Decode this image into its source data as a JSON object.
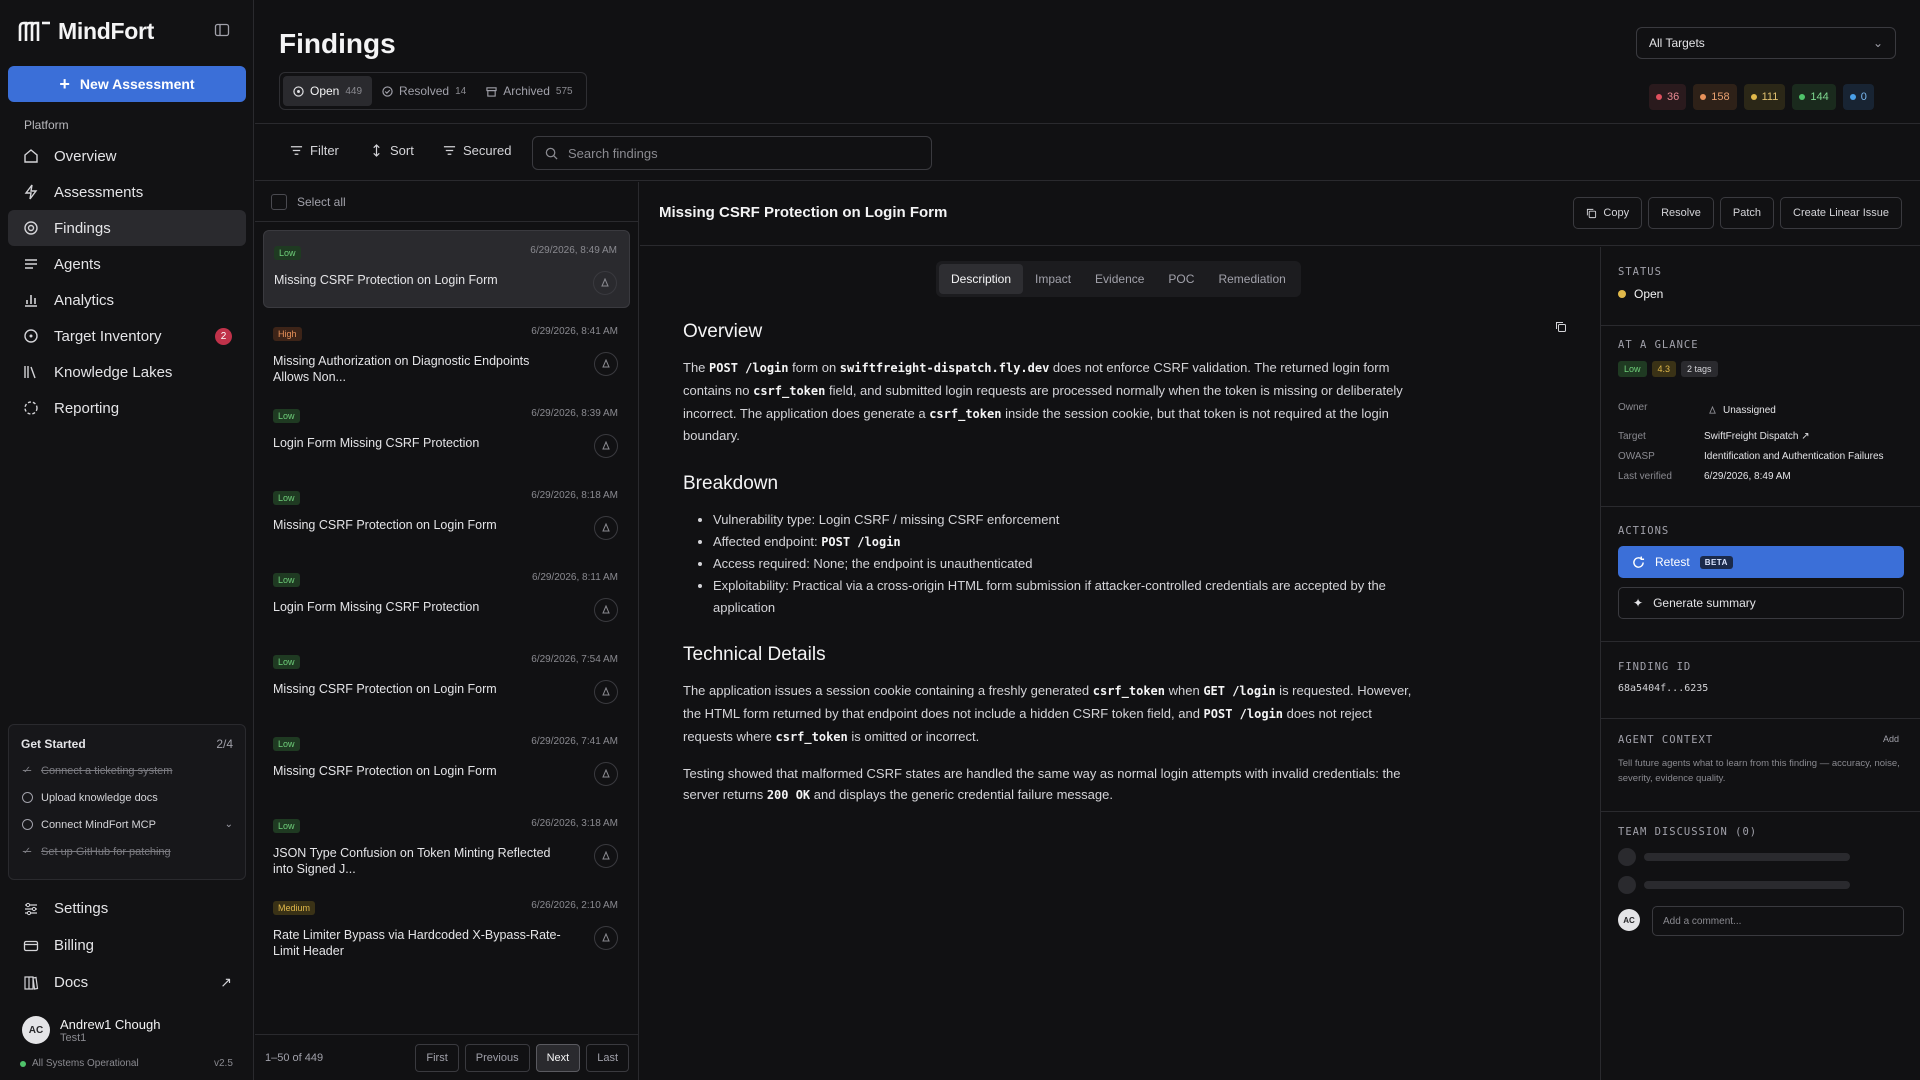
{
  "app": {
    "name": "MindFort"
  },
  "sidebar": {
    "new_assessment": "New Assessment",
    "section_label": "Platform",
    "items": [
      {
        "label": "Overview",
        "icon": "home-icon"
      },
      {
        "label": "Assessments",
        "icon": "bolt-icon"
      },
      {
        "label": "Findings",
        "icon": "target-icon",
        "active": true
      },
      {
        "label": "Agents",
        "icon": "list-icon"
      },
      {
        "label": "Analytics",
        "icon": "bar-chart-icon"
      },
      {
        "label": "Target Inventory",
        "icon": "crosshair-icon",
        "badge": "2"
      },
      {
        "label": "Knowledge Lakes",
        "icon": "library-icon"
      },
      {
        "label": "Reporting",
        "icon": "loader-icon"
      }
    ],
    "get_started": {
      "title": "Get Started",
      "progress": "2/4",
      "steps": [
        {
          "label": "Connect a ticketing system",
          "done": true
        },
        {
          "label": "Upload knowledge docs",
          "done": false
        },
        {
          "label": "Connect MindFort MCP",
          "done": false
        },
        {
          "label": "Set up GitHub for patching",
          "done": true
        }
      ]
    },
    "bottom": [
      {
        "label": "Settings",
        "icon": "sliders-icon"
      },
      {
        "label": "Billing",
        "icon": "credit-card-icon"
      },
      {
        "label": "Docs",
        "icon": "book-icon"
      }
    ],
    "user": {
      "initials": "AC",
      "name": "Andrew1 Chough",
      "org": "Test1"
    },
    "status": "All Systems Operational",
    "version": "v2.5"
  },
  "header": {
    "title": "Findings",
    "tabs": [
      {
        "label": "Open",
        "count": "449"
      },
      {
        "label": "Resolved",
        "count": "14"
      },
      {
        "label": "Archived",
        "count": "575"
      }
    ],
    "target_select": "All Targets",
    "severity_counts": [
      {
        "value": "36",
        "color": "#e0505e",
        "bg": "#2a1a1d",
        "fg": "#e88a92"
      },
      {
        "value": "158",
        "color": "#e8915a",
        "bg": "#2e2118",
        "fg": "#e8a070"
      },
      {
        "value": "111",
        "color": "#e0b84a",
        "bg": "#2b2717",
        "fg": "#e0c070"
      },
      {
        "value": "144",
        "color": "#4fc26a",
        "bg": "#1a2a1d",
        "fg": "#7fd890"
      },
      {
        "value": "0",
        "color": "#4aa0e8",
        "bg": "#182433",
        "fg": "#7ab8f0"
      }
    ]
  },
  "toolbar": {
    "filter": "Filter",
    "sort": "Sort",
    "secured": "Secured",
    "search_placeholder": "Search findings"
  },
  "list": {
    "select_all": "Select all",
    "items": [
      {
        "severity": "Low",
        "date": "6/29/2026, 8:49 AM",
        "title": "Missing CSRF Protection on Login Form",
        "active": true
      },
      {
        "severity": "High",
        "date": "6/29/2026, 8:41 AM",
        "title": "Missing Authorization on Diagnostic Endpoints Allows Non..."
      },
      {
        "severity": "Low",
        "date": "6/29/2026, 8:39 AM",
        "title": "Login Form Missing CSRF Protection"
      },
      {
        "severity": "Low",
        "date": "6/29/2026, 8:18 AM",
        "title": "Missing CSRF Protection on Login Form"
      },
      {
        "severity": "Low",
        "date": "6/29/2026, 8:11 AM",
        "title": "Login Form Missing CSRF Protection"
      },
      {
        "severity": "Low",
        "date": "6/29/2026, 7:54 AM",
        "title": "Missing CSRF Protection on Login Form"
      },
      {
        "severity": "Low",
        "date": "6/29/2026, 7:41 AM",
        "title": "Missing CSRF Protection on Login Form"
      },
      {
        "severity": "Low",
        "date": "6/26/2026, 3:18 AM",
        "title": "JSON Type Confusion on Token Minting Reflected into Signed J..."
      },
      {
        "severity": "Medium",
        "date": "6/26/2026, 2:10 AM",
        "title": "Rate Limiter Bypass via Hardcoded X-Bypass-Rate-Limit Header"
      }
    ],
    "pagination": {
      "info": "1–50 of 449",
      "first": "First",
      "previous": "Previous",
      "next": "Next",
      "last": "Last"
    }
  },
  "detail": {
    "title": "Missing CSRF Protection on Login Form",
    "actions": {
      "copy": "Copy",
      "resolve": "Resolve",
      "patch": "Patch",
      "linear": "Create Linear Issue"
    },
    "tabs": [
      "Description",
      "Impact",
      "Evidence",
      "POC",
      "Remediation"
    ],
    "overview": {
      "heading": "Overview",
      "t1": "The ",
      "c1": "POST /login",
      "t2": " form on ",
      "c2": "swiftfreight-dispatch.fly.dev",
      "t3": " does not enforce CSRF validation. The returned login form contains no ",
      "c3": "csrf_token",
      "t4": " field, and submitted login requests are processed normally when the token is missing or deliberately incorrect. The application does generate a ",
      "c4": "csrf_token",
      "t5": " inside the session cookie, but that token is not required at the login boundary."
    },
    "breakdown": {
      "heading": "Breakdown",
      "b1": "Vulnerability type: Login CSRF / missing CSRF enforcement",
      "b2_text": "Affected endpoint: ",
      "b2_code": "POST /login",
      "b3": "Access required: None; the endpoint is unauthenticated",
      "b4": "Exploitability: Practical via a cross-origin HTML form submission if attacker-controlled credentials are accepted by the application"
    },
    "technical": {
      "heading": "Technical Details",
      "p1_t1": "The application issues a session cookie containing a freshly generated ",
      "p1_c1": "csrf_token",
      "p1_t2": " when ",
      "p1_c2": "GET /login",
      "p1_t3": " is requested. However, the HTML form returned by that endpoint does not include a hidden CSRF token field, and ",
      "p1_c3": "POST /login",
      "p1_t4": " does not reject requests where ",
      "p1_c4": "csrf_token",
      "p1_t5": " is omitted or incorrect.",
      "p2_t1": "Testing showed that malformed CSRF states are handled the same way as normal login attempts with invalid credentials: the server returns ",
      "p2_c1": "200 OK",
      "p2_t2": " and displays the generic credential failure message."
    }
  },
  "panel": {
    "status_label": "STATUS",
    "status": "Open",
    "glance_label": "AT A GLANCE",
    "chips": {
      "severity": "Low",
      "score": "4.3",
      "tags": "2 tags"
    },
    "owner_label": "Owner",
    "owner": "Unassigned",
    "target_label": "Target",
    "target": "SwiftFreight Dispatch ↗",
    "owasp_label": "OWASP",
    "owasp": "Identification and Authentication Failures",
    "verified_label": "Last verified",
    "verified": "6/29/2026, 8:49 AM",
    "actions_label": "ACTIONS",
    "retest": "Retest",
    "beta": "BETA",
    "generate": "Generate summary",
    "finding_id_label": "FINDING ID",
    "finding_id": "68a5404f...6235",
    "agent_context_label": "AGENT CONTEXT",
    "agent_add": "Add",
    "agent_context_text": "Tell future agents what to learn from this finding — accuracy, noise, severity, evidence quality.",
    "discussion_label": "TEAM DISCUSSION (0)",
    "comment_initials": "AC",
    "comment_placeholder": "Add a comment..."
  }
}
